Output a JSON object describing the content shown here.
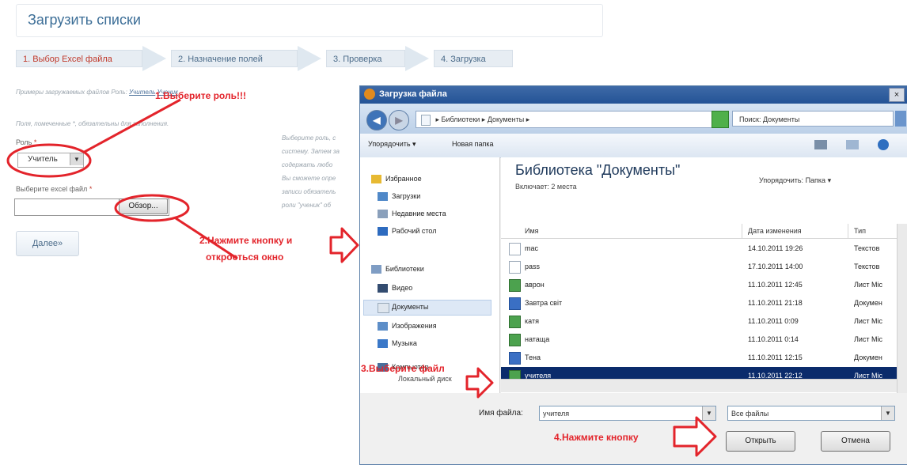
{
  "page": {
    "title": "Загрузить списки",
    "steps": [
      "1. Выбор Excel файла",
      "2. Назначение полей",
      "3. Проверка",
      "4. Загрузка"
    ],
    "example_text": "Примеры загружаемых файлов Роль:",
    "example_link1": "Учитель",
    "example_link2": "Ученик",
    "required_note": "Поля, помеченные *, обязательны для заполнения.",
    "role_label": "Роль",
    "role_value": "Учитель",
    "file_label": "Выберите excel файл",
    "required_mark": "*",
    "browse_label": "Обзор...",
    "next_label": "Далее»",
    "help_lines": [
      "Выберите роль, с",
      "систему. Затем за",
      "содержать любо",
      "Вы сможете опре",
      "записи обязатель",
      "роли \"ученик\" об"
    ]
  },
  "annotations": {
    "a1": "1.Выберите роль!!!",
    "a2_line1": "2.Нажмите кнопку и",
    "a2_line2": "откроеться окно",
    "a3": "3.Выберите файл",
    "a4": "4.Нажмите кнопку",
    "color": "#e3242b"
  },
  "dialog": {
    "title": "Загрузка файла",
    "close": "×",
    "breadcrumb": "▸ Библиотеки ▸ Документы ▸",
    "search_placeholder": "Поиск: Документы",
    "toolbar": {
      "organize": "Упорядочить ▾",
      "new_folder": "Новая папка"
    },
    "nav": {
      "favorites": "Избранное",
      "downloads": "Загрузки",
      "recent": "Недавние места",
      "desktop": "Рабочий стол",
      "libraries": "Библиотеки",
      "video": "Видео",
      "documents": "Документы",
      "images": "Изображения",
      "music": "Музыка",
      "computer": "Компьютер",
      "local_disk": "Локальный диск"
    },
    "library": {
      "title": "Библиотека \"Документы\"",
      "includes": "Включает: 2 места",
      "arrange_label": "Упорядочить:",
      "arrange_value": "Папка ▾"
    },
    "columns": {
      "name": "Имя",
      "date": "Дата изменения",
      "type": "Тип"
    },
    "files": [
      {
        "name": "mac",
        "date": "14.10.2011 19:26",
        "type": "Текстов",
        "icon": "txt"
      },
      {
        "name": "pass",
        "date": "17.10.2011 14:00",
        "type": "Текстов",
        "icon": "txt"
      },
      {
        "name": "аврон",
        "date": "11.10.2011 12:45",
        "type": "Лист Mic",
        "icon": "xls"
      },
      {
        "name": "Завтра світ",
        "date": "11.10.2011 21:18",
        "type": "Докумен",
        "icon": "doc"
      },
      {
        "name": "катя",
        "date": "11.10.2011 0:09",
        "type": "Лист Mic",
        "icon": "xls"
      },
      {
        "name": "натаща",
        "date": "11.10.2011 0:14",
        "type": "Лист Mic",
        "icon": "xls"
      },
      {
        "name": "Тена",
        "date": "11.10.2011 12:15",
        "type": "Докумен",
        "icon": "doc"
      },
      {
        "name": "учителя",
        "date": "11.10.2011 22:12",
        "type": "Лист Mic",
        "icon": "xls"
      }
    ],
    "selected_index": 7,
    "filename_label": "Имя файла:",
    "filename_value": "учителя",
    "filetype_value": "Все файлы",
    "open_label": "Открыть",
    "cancel_label": "Отмена"
  }
}
